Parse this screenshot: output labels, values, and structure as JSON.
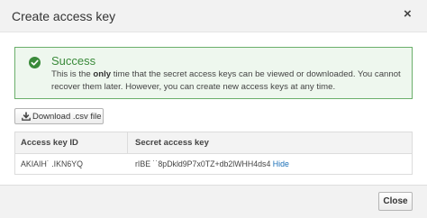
{
  "dialog": {
    "title": "Create access key",
    "close_icon": "×"
  },
  "alert": {
    "icon": "check-circle-icon",
    "icon_color": "#3a8a3a",
    "heading": "Success",
    "text_before": "This is the ",
    "text_bold": "only",
    "text_after": " time that the secret access keys can be viewed or downloaded. You cannot recover them later. However, you can create new access keys at any time."
  },
  "download_button": {
    "icon": "download-icon",
    "label": "Download .csv file"
  },
  "table": {
    "headers": [
      "Access key ID",
      "Secret access key"
    ],
    "rows": [
      {
        "access_key_id": "AKIAIH˙          .IKN6YQ",
        "secret_access_key": "rIBE                      ˙˙8pDkld9P7x0TZ+db2lWHH4ds4",
        "action": "Hide"
      }
    ]
  },
  "footer": {
    "close_label": "Close"
  }
}
